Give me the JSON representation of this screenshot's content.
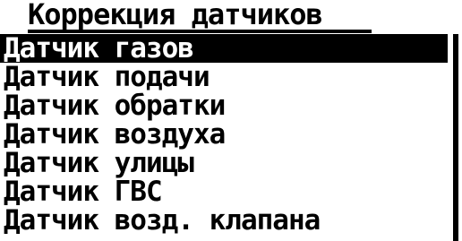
{
  "screen": {
    "title": "Коррекция датчиков",
    "menu": {
      "items": [
        {
          "label": "Датчик газов",
          "selected": true
        },
        {
          "label": "Датчик подачи",
          "selected": false
        },
        {
          "label": "Датчик обратки",
          "selected": false
        },
        {
          "label": "Датчик воздуха",
          "selected": false
        },
        {
          "label": "Датчик улицы",
          "selected": false
        },
        {
          "label": "Датчик ГВС",
          "selected": false
        },
        {
          "label": "Датчик возд. клапана",
          "selected": false
        }
      ]
    }
  },
  "colors": {
    "background": "#ffffff",
    "foreground": "#000000",
    "highlight_bg": "#000000",
    "highlight_fg": "#ffffff"
  }
}
